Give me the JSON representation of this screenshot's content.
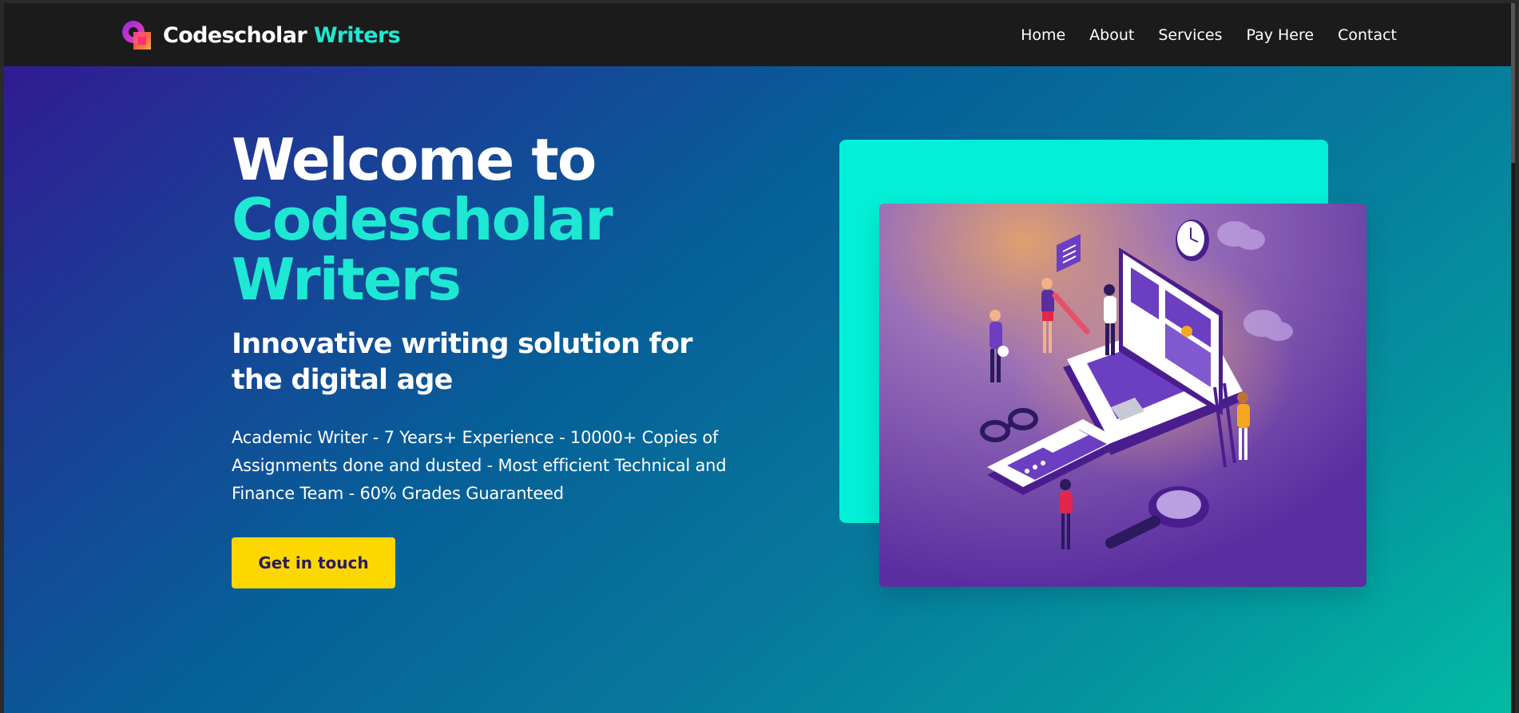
{
  "brand": {
    "name_main": "Codescholar",
    "name_accent": "Writers",
    "logo_icon": "brand-logo-icon"
  },
  "nav": {
    "items": [
      {
        "label": "Home"
      },
      {
        "label": "About"
      },
      {
        "label": "Services"
      },
      {
        "label": "Pay Here"
      },
      {
        "label": "Contact"
      }
    ]
  },
  "hero": {
    "title_line1": "Welcome to",
    "title_line2": "Codescholar",
    "title_line3": "Writers",
    "subtitle": "Innovative writing solution for the digital age",
    "description": "Academic Writer - 7 Years+ Experience - 10000+ Copies of Assignments done and dusted - Most efficient Technical and Finance Team - 60% Grades Guaranteed",
    "cta_label": "Get in touch"
  },
  "colors": {
    "accent": "#1ee8d3",
    "cta": "#fcd800",
    "navbar": "#1b1b1b",
    "panel": "#03f0d8"
  }
}
